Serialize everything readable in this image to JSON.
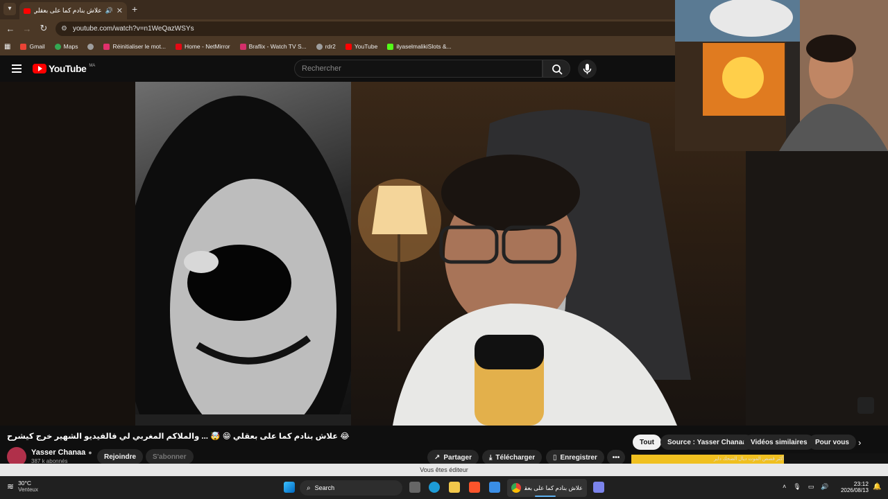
{
  "browser": {
    "tab_title": "علاش بنادم كما على بعقلي 😂",
    "url": "youtube.com/watch?v=n1WeQazWSYs",
    "bookmarks": [
      {
        "label": "Gmail",
        "color": "#ea4335"
      },
      {
        "label": "Maps",
        "color": "#34a853"
      },
      {
        "label": "",
        "color": "#9e9e9e"
      },
      {
        "label": "Réinitialiser le mot...",
        "color": "#e1306c"
      },
      {
        "label": "Home - NetMirror",
        "color": "#e50914"
      },
      {
        "label": "Braflix - Watch TV S...",
        "color": "#d32f6a"
      },
      {
        "label": "rdr2",
        "color": "#9e9e9e"
      },
      {
        "label": "YouTube",
        "color": "#ff0000"
      },
      {
        "label": "ilyaselmalikiSlots &...",
        "color": "#53fc18"
      }
    ]
  },
  "youtube": {
    "logo_text": "YouTube",
    "country_code": "MA",
    "search_placeholder": "Rechercher"
  },
  "video": {
    "title": "😂 علاش بنادم كما على بعقلي 😁 🤯 ... والملاكم المغربي لي فالفيديو الشهير خرج كيشرح",
    "channel": "Yasser Chanaa",
    "subscribers": "387 k abonnés",
    "join_label": "Rejoindre",
    "subscribe_label": "S'abonner",
    "actions": {
      "share": "Partager",
      "download": "Télécharger",
      "save": "Enregistrer"
    }
  },
  "chips": [
    "Tout",
    "Source : Yasser Chanaa",
    "Vidéos similaires",
    "Pour vous"
  ],
  "editor_banner": "Vous êtes éditeur",
  "promo_text": "أكثر قصص الموت ديال الضحك داير",
  "taskbar": {
    "weather_temp": "30°C",
    "weather_desc": "Venteux",
    "search_label": "Search",
    "chrome_item": "علاش بنادم كما على بعقلي",
    "time": "23:12",
    "date": "2026/08/13"
  }
}
